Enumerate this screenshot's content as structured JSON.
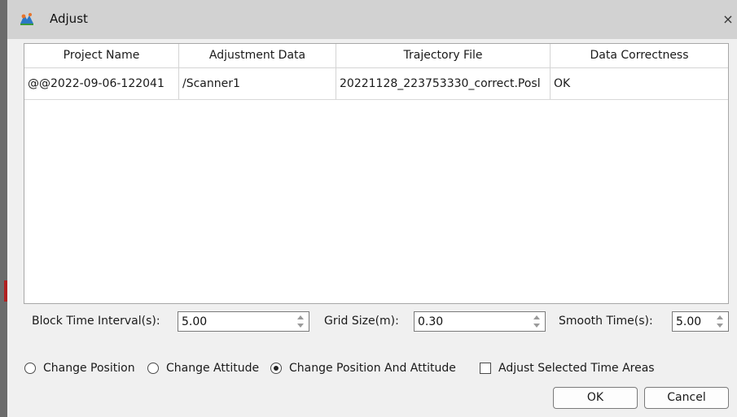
{
  "window": {
    "title": "Adjust",
    "close_glyph": "×",
    "app_icon": "app-logo-icon"
  },
  "table": {
    "columns": [
      "Project Name",
      "Adjustment Data",
      "Trajectory File",
      "Data Correctness"
    ],
    "rows": [
      [
        "@@2022-09-06-122041",
        "/Scanner1",
        "20221128_223753330_correct.Posl",
        "OK"
      ]
    ]
  },
  "params": {
    "block_time": {
      "label": "Block Time Interval(s):",
      "value": "5.00"
    },
    "grid_size": {
      "label": "Grid Size(m):",
      "value": "0.30"
    },
    "smooth_time": {
      "label": "Smooth Time(s):",
      "value": "5.00"
    }
  },
  "options": {
    "change_position": {
      "label": "Change Position",
      "checked": false
    },
    "change_attitude": {
      "label": "Change Attitude",
      "checked": false
    },
    "change_both": {
      "label": "Change Position And Attitude",
      "checked": true
    },
    "adjust_selected": {
      "label": "Adjust Selected Time Areas",
      "checked": false
    }
  },
  "buttons": {
    "ok": "OK",
    "cancel": "Cancel"
  }
}
